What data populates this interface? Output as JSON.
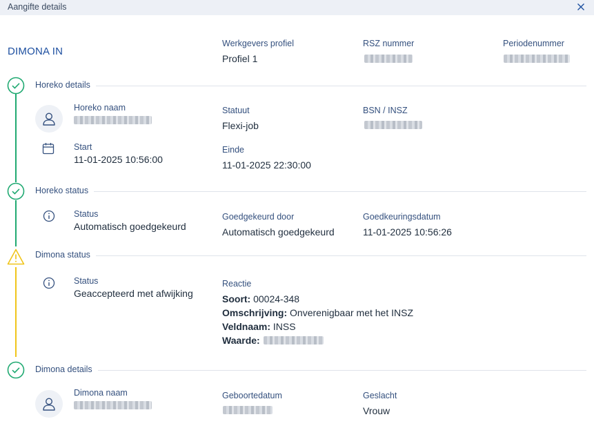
{
  "window": {
    "title": "Aangifte details"
  },
  "header": {
    "heading": "DIMONA IN",
    "werkgevers_profiel_label": "Werkgevers profiel",
    "werkgevers_profiel_value": "Profiel 1",
    "rsz_label": "RSZ nummer",
    "periode_label": "Periodenummer"
  },
  "horeko_details": {
    "title": "Horeko details",
    "naam_label": "Horeko naam",
    "statuut_label": "Statuut",
    "statuut_value": "Flexi-job",
    "bsn_label": "BSN / INSZ",
    "start_label": "Start",
    "start_value": "11-01-2025 10:56:00",
    "einde_label": "Einde",
    "einde_value": "11-01-2025 22:30:00"
  },
  "horeko_status": {
    "title": "Horeko status",
    "status_label": "Status",
    "status_value": "Automatisch goedgekeurd",
    "goedgekeurd_door_label": "Goedgekeurd door",
    "goedgekeurd_door_value": "Automatisch goedgekeurd",
    "goedkeuringsdatum_label": "Goedkeuringsdatum",
    "goedkeuringsdatum_value": "11-01-2025 10:56:26"
  },
  "dimona_status": {
    "title": "Dimona status",
    "status_label": "Status",
    "status_value": "Geaccepteerd met afwijking",
    "reactie_label": "Reactie",
    "soort_key": "Soort:",
    "soort_value": " 00024-348",
    "omschrijving_key": "Omschrijving:",
    "omschrijving_value": " Onverenigbaar met het INSZ",
    "veldnaam_key": "Veldnaam:",
    "veldnaam_value": " INSS",
    "waarde_key": "Waarde:"
  },
  "dimona_details": {
    "title": "Dimona details",
    "naam_label": "Dimona naam",
    "geboortedatum_label": "Geboortedatum",
    "geslacht_label": "Geslacht",
    "geslacht_value": "Vrouw"
  },
  "colors": {
    "success": "#1fa971",
    "warning": "#f0c419",
    "accent": "#1d4fa0"
  },
  "icons": [
    "close-icon",
    "check-circle-icon",
    "warning-triangle-icon",
    "user-icon",
    "calendar-icon",
    "info-icon"
  ]
}
